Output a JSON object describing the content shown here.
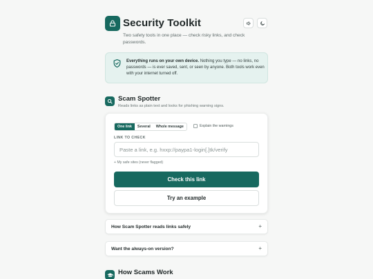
{
  "header": {
    "title": "Security Toolkit",
    "subtitle": "Two safety tools in one place — check risky links, and check passwords.",
    "sound_icon": "speaker-icon",
    "theme_icon": "moon-icon",
    "logo_icon": "lock-icon"
  },
  "notice": {
    "icon": "shield-check-icon",
    "bold": "Everything runs on your own device.",
    "text": " Nothing you type — no links, no passwords — is ever saved, sent, or seen by anyone. Both tools work even with your internet turned off."
  },
  "scam_spotter": {
    "icon": "search-icon",
    "title": "Scam Spotter",
    "subtitle": "Reads links as plain text and looks for phishing warning signs.",
    "modes": [
      "One link",
      "Several",
      "Whole message"
    ],
    "active_mode": "One link",
    "explain_label": "Explain the warnings",
    "explain_checked": false,
    "field_label": "LINK TO CHECK",
    "input_placeholder": "Paste a link, e.g. hxxp://paypa1-login[.]tk/verify",
    "input_value": "",
    "safe_sites": "+ My safe sites (never flagged)",
    "check_button": "Check this link",
    "example_button": "Try an example"
  },
  "accordions": [
    {
      "label": "How Scam Spotter reads links safely",
      "toggle": "+"
    },
    {
      "label": "Want the always-on version?",
      "toggle": "+"
    }
  ],
  "how_scams": {
    "icon": "graduation-cap-icon",
    "title": "How Scams Work"
  },
  "colors": {
    "accent": "#17695f",
    "notice_bg": "#e5f2ef",
    "page_bg": "#f6f7f6"
  }
}
